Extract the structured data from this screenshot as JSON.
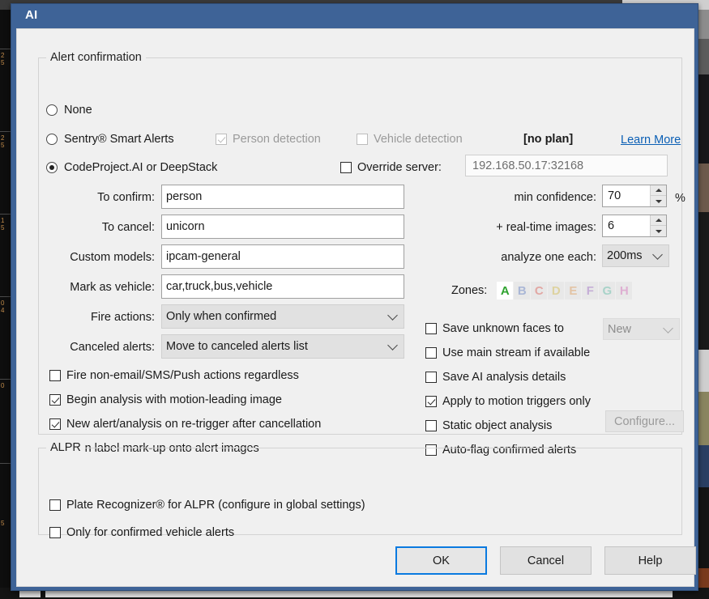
{
  "window": {
    "title": "AI"
  },
  "groups": {
    "alert_confirmation": "Alert confirmation",
    "alpr": "ALPR"
  },
  "mode": {
    "none": "None",
    "sentry": "Sentry® Smart Alerts",
    "codeproject": "CodeProject.AI or DeepStack",
    "selected": "codeproject"
  },
  "sentry": {
    "person_detection": "Person detection",
    "person_detection_checked": true,
    "vehicle_detection": "Vehicle detection",
    "vehicle_detection_checked": false,
    "plan_status": "[no plan]",
    "learn_more": "Learn More"
  },
  "server": {
    "override_label": "Override server:",
    "override_checked": false,
    "address_value": "192.168.50.17:32168"
  },
  "fields": {
    "to_confirm_label": "To confirm:",
    "to_confirm_value": "person",
    "to_cancel_label": "To cancel:",
    "to_cancel_value": "unicorn",
    "custom_models_label": "Custom models:",
    "custom_models_value": "ipcam-general",
    "mark_as_vehicle_label": "Mark as vehicle:",
    "mark_as_vehicle_value": "car,truck,bus,vehicle",
    "fire_actions_label": "Fire actions:",
    "fire_actions_value": "Only when confirmed",
    "canceled_alerts_label": "Canceled alerts:",
    "canceled_alerts_value": "Move to canceled alerts list"
  },
  "analysis": {
    "min_confidence_label": "min confidence:",
    "min_confidence_value": "70",
    "percent_sign": "%",
    "realtime_images_label": "+ real-time images:",
    "realtime_images_value": "6",
    "analyze_one_each_label": "analyze one each:",
    "analyze_one_each_value": "200ms"
  },
  "zones": {
    "label": "Zones:",
    "items": [
      {
        "letter": "A",
        "color": "#2fa32f",
        "active": true
      },
      {
        "letter": "B",
        "color": "#aab7d6",
        "active": false
      },
      {
        "letter": "C",
        "color": "#e2a8a4",
        "active": false
      },
      {
        "letter": "D",
        "color": "#ded3a0",
        "active": false
      },
      {
        "letter": "E",
        "color": "#e3c4a5",
        "active": false
      },
      {
        "letter": "F",
        "color": "#c5aed6",
        "active": false
      },
      {
        "letter": "G",
        "color": "#a9d3c9",
        "active": false
      },
      {
        "letter": "H",
        "color": "#deafd2",
        "active": false
      }
    ]
  },
  "left_checks": [
    {
      "label": "Fire non-email/SMS/Push actions regardless",
      "checked": false
    },
    {
      "label": "Begin analysis with motion-leading image",
      "checked": true
    },
    {
      "label": "New alert/analysis on re-trigger after cancellation",
      "checked": true
    },
    {
      "label": "Burn label mark-up onto alert images",
      "checked": true
    }
  ],
  "right_checks": [
    {
      "label": "Save unknown faces to",
      "checked": false
    },
    {
      "label": "Use main stream if available",
      "checked": false
    },
    {
      "label": "Save AI analysis details",
      "checked": false
    },
    {
      "label": "Apply to motion triggers only",
      "checked": true
    },
    {
      "label": "Static object analysis",
      "checked": false
    },
    {
      "label": "Auto-flag confirmed alerts",
      "checked": false
    }
  ],
  "right_extras": {
    "faces_folder_value": "New",
    "configure_button": "Configure..."
  },
  "alpr_checks": [
    {
      "label": "Plate Recognizer® for ALPR (configure in global settings)",
      "checked": false
    },
    {
      "label": "Only for confirmed vehicle alerts",
      "checked": false
    }
  ],
  "footer": {
    "ok": "OK",
    "cancel": "Cancel",
    "help": "Help"
  },
  "background": {
    "tick_labels": [
      "2",
      "5",
      "2",
      "5",
      "1",
      "5",
      "0",
      "4",
      "0",
      "1",
      "5"
    ]
  }
}
